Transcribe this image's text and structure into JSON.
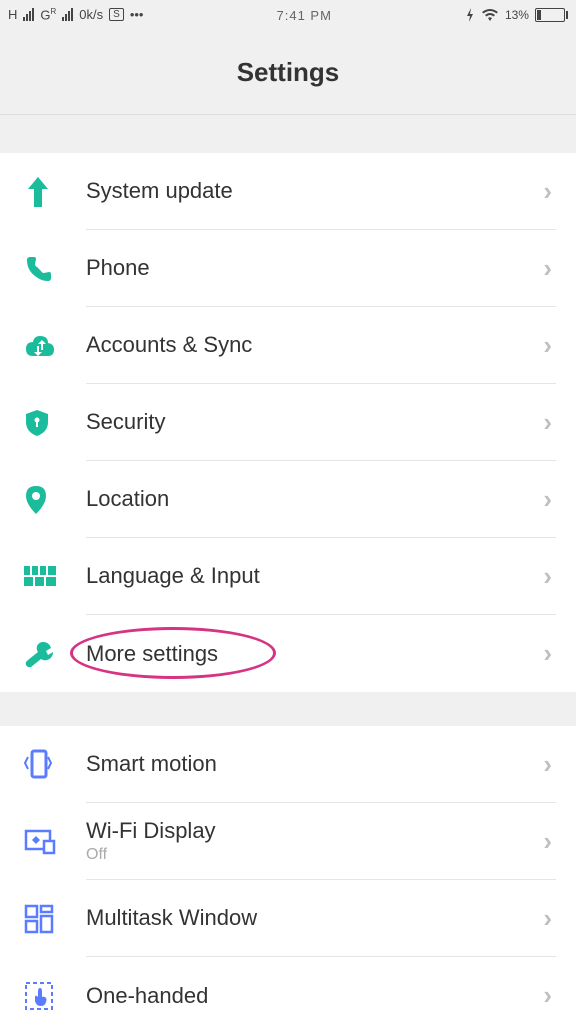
{
  "status": {
    "signal1_label": "H",
    "signal2_label": "G",
    "signal2_sup": "R",
    "speed": "0k/s",
    "time": "7:41 PM",
    "battery_pct": "13%"
  },
  "header": {
    "title": "Settings"
  },
  "group1": [
    {
      "icon": "arrow-up",
      "label": "System update"
    },
    {
      "icon": "phone",
      "label": "Phone"
    },
    {
      "icon": "cloud-sync",
      "label": "Accounts & Sync"
    },
    {
      "icon": "shield",
      "label": "Security"
    },
    {
      "icon": "location-pin",
      "label": "Location"
    },
    {
      "icon": "keyboard",
      "label": "Language & Input"
    },
    {
      "icon": "wrench",
      "label": "More settings",
      "highlighted": true
    }
  ],
  "group2": [
    {
      "icon": "smart-motion",
      "label": "Smart motion"
    },
    {
      "icon": "wifi-display",
      "label": "Wi-Fi Display",
      "sub": "Off"
    },
    {
      "icon": "multitask",
      "label": "Multitask Window"
    },
    {
      "icon": "one-handed",
      "label": "One-handed"
    }
  ]
}
